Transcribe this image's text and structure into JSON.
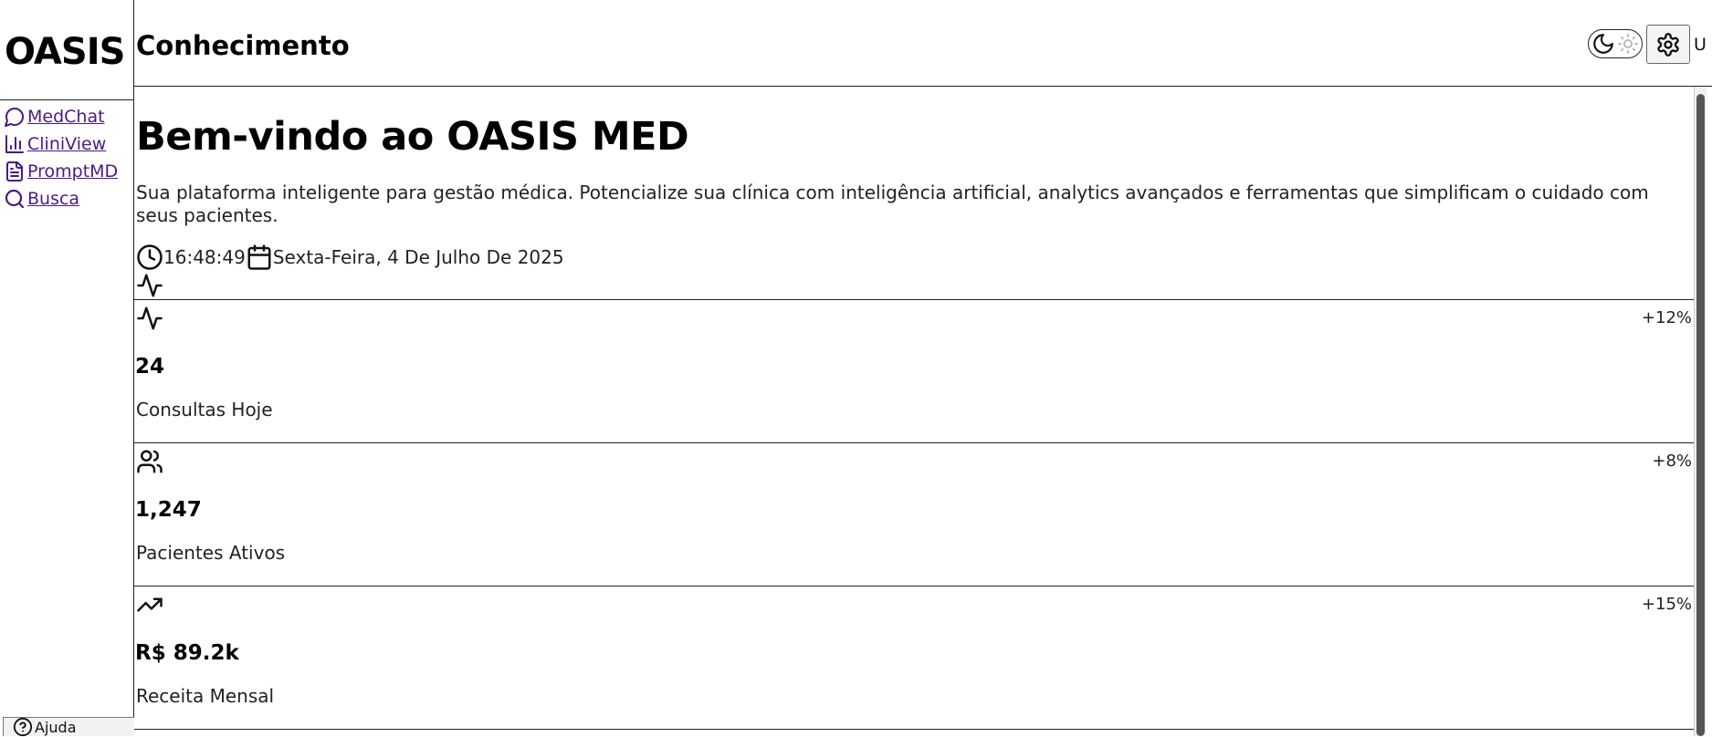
{
  "sidebar": {
    "brand": "OASIS",
    "items": [
      {
        "label": "MedChat",
        "icon": "chat-bubble-icon"
      },
      {
        "label": "CliniView",
        "icon": "bar-chart-icon"
      },
      {
        "label": "PromptMD",
        "icon": "document-icon"
      },
      {
        "label": "Busca",
        "icon": "search-icon"
      }
    ],
    "help_label": "Ajuda"
  },
  "header": {
    "title": "Conhecimento",
    "user_initial": "U"
  },
  "welcome": {
    "title": "Bem-vindo ao OASIS MED",
    "description": "Sua plataforma inteligente para gestão médica. Potencialize sua clínica com inteligência artificial, analytics avançados e ferramentas que simplificam o cuidado com seus pacientes.",
    "time": "16:48:49",
    "date": "Sexta-Feira, 4 De Julho De 2025"
  },
  "stats": [
    {
      "icon": "activity-icon",
      "change": "+12%",
      "value": "24",
      "label": "Consultas Hoje"
    },
    {
      "icon": "users-icon",
      "change": "+8%",
      "value": "1,247",
      "label": "Pacientes Ativos"
    },
    {
      "icon": "trending-up-icon",
      "change": "+15%",
      "value": "R$ 89.2k",
      "label": "Receita Mensal"
    }
  ],
  "colors": {
    "nav_link": "#4b1a86",
    "border": "#222222",
    "background": "#ffffff"
  }
}
